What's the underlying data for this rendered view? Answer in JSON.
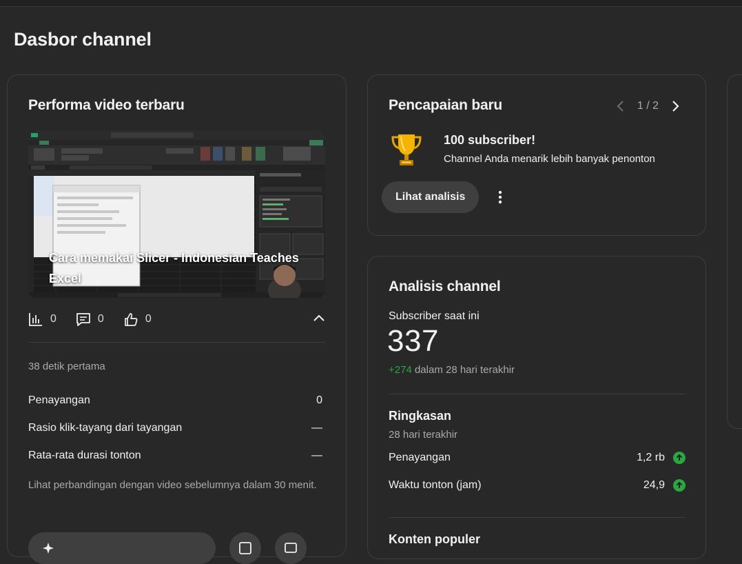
{
  "page": {
    "title": "Dasbor channel"
  },
  "latest_video": {
    "card_title": "Performa video terbaru",
    "video_title": "Cara memakai Slicer - Indonesian Teaches Excel",
    "stats": {
      "views": "0",
      "comments": "0",
      "likes": "0"
    },
    "period": "38 detik pertama",
    "metrics": [
      {
        "label": "Penayangan",
        "value": "0"
      },
      {
        "label": "Rasio klik-tayang dari tayangan",
        "value": "—"
      },
      {
        "label": "Rata-rata durasi tonton",
        "value": "—"
      }
    ],
    "note": "Lihat perbandingan dengan video sebelumnya dalam 30 menit."
  },
  "achievements": {
    "card_title": "Pencapaian baru",
    "pager": "1 / 2",
    "title": "100 subscriber!",
    "description": "Channel Anda menarik lebih banyak penonton",
    "button_label": "Lihat analisis"
  },
  "analytics": {
    "card_title": "Analisis channel",
    "subscribers_label": "Subscriber saat ini",
    "subscribers_count": "337",
    "subscribers_delta": "+274",
    "subscribers_delta_suffix": " dalam 28 hari terakhir",
    "summary_title": "Ringkasan",
    "summary_period": "28 hari terakhir",
    "summary_rows": [
      {
        "label": "Penayangan",
        "value": "1,2 rb"
      },
      {
        "label": "Waktu tonton (jam)",
        "value": "24,9"
      }
    ],
    "popular_title": "Konten populer"
  },
  "colors": {
    "background": "#282828",
    "positive": "#2ba640",
    "card_border": "#3e3e3e",
    "pill": "#3f3f3f"
  }
}
